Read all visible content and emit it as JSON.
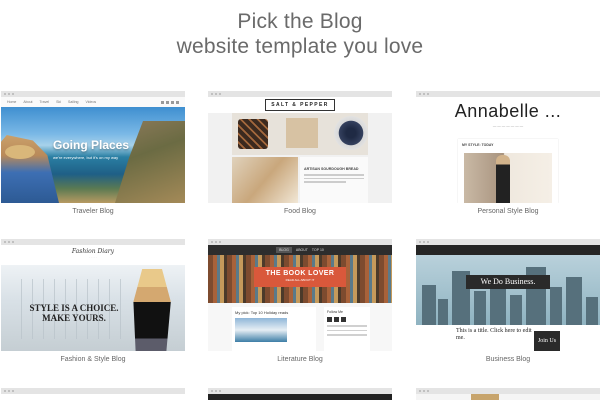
{
  "heading": {
    "line1": "Pick the Blog",
    "line2": "website template you love"
  },
  "templates": [
    {
      "caption": "Traveler Blog",
      "nav": [
        "Home",
        "About",
        "Travel",
        "Ski",
        "Sailing",
        "Videos"
      ],
      "hero_title": "Going Places",
      "hero_subtitle": "we're everywhere, but it's on my way"
    },
    {
      "caption": "Food Blog",
      "logo": "SALT & PEPPER",
      "post_title": "ARTISAN SOURDOUGH BREAD"
    },
    {
      "caption": "Personal Style Blog",
      "name": "Annabelle ...",
      "post_title": "MY STYLE: TODAY"
    },
    {
      "caption": "Fashion & Style Blog",
      "signature": "Fashion Diary",
      "hero_text": "STYLE IS A CHOICE. MAKE YOURS."
    },
    {
      "caption": "Literature Blog",
      "tabs": [
        "BLOG",
        "ABOUT",
        "TOP 10"
      ],
      "banner_title": "THE BOOK LOVER",
      "banner_subtitle": "READ ALL ABOUT IT",
      "post_title": "My pick: Top 10 Holiday reads",
      "side_title": "Follow Me"
    },
    {
      "caption": "Business Blog",
      "badge": "We Do Business.",
      "lower_text": "This is a title. Click here to edit me.",
      "join": "Join Us"
    }
  ]
}
